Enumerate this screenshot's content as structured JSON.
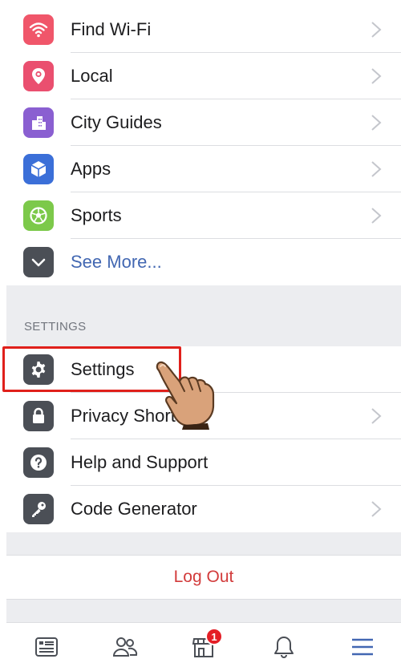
{
  "menu": {
    "items": [
      {
        "label": "Find Wi-Fi",
        "icon": "wifi-icon",
        "color": "#f0566a",
        "chevron": true
      },
      {
        "label": "Local",
        "icon": "location-pin-icon",
        "color": "#ea4f6f",
        "chevron": true
      },
      {
        "label": "City Guides",
        "icon": "city-buildings-icon",
        "color": "#8a5fd1",
        "chevron": true
      },
      {
        "label": "Apps",
        "icon": "cube-icon",
        "color": "#3b6fd8",
        "chevron": true
      },
      {
        "label": "Sports",
        "icon": "soccer-ball-icon",
        "color": "#7cc94a",
        "chevron": true
      },
      {
        "label": "See More...",
        "icon": "chevron-down-icon",
        "color": "#4b4f56",
        "chevron": false
      }
    ]
  },
  "settings_section": {
    "header": "SETTINGS",
    "items": [
      {
        "label": "Settings",
        "icon": "gear-icon",
        "color": "#4b4f56",
        "chevron": false
      },
      {
        "label": "Privacy Shortcuts",
        "icon": "lock-icon",
        "color": "#4b4f56",
        "chevron": true
      },
      {
        "label": "Help and Support",
        "icon": "question-icon",
        "color": "#4b4f56",
        "chevron": false
      },
      {
        "label": "Code Generator",
        "icon": "key-icon",
        "color": "#4b4f56",
        "chevron": true
      }
    ]
  },
  "logout": {
    "label": "Log Out",
    "color": "#d23b3b"
  },
  "tabbar": {
    "tabs": [
      {
        "icon": "news-feed-icon"
      },
      {
        "icon": "friends-icon"
      },
      {
        "icon": "marketplace-icon",
        "badge": "1"
      },
      {
        "icon": "bell-icon"
      },
      {
        "icon": "menu-icon",
        "active": true
      }
    ]
  },
  "colors": {
    "accent": "#4267b2",
    "highlight": "#e0201b",
    "badge": "#e41e26"
  }
}
